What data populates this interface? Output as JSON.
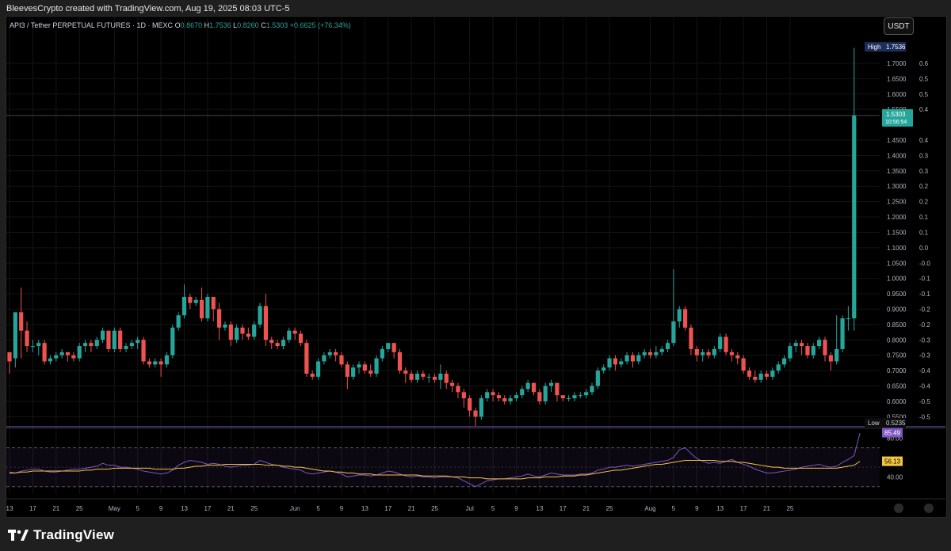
{
  "caption": "BleevesCrypto created with TradingView.com, Aug 19, 2025 08:03 UTC-5",
  "brand": "TradingView",
  "currency_button": "USDT",
  "legend": {
    "symbol": "API3 / Tether PERPETUAL FUTURES · 1D · MEXC",
    "o_label": "O",
    "o_value": "0.8670",
    "h_label": "H",
    "h_value": "1.7536",
    "l_label": "L",
    "l_value": "0.8260",
    "c_label": "C",
    "c_value": "1.5303",
    "change": "+0.6625 (+76.34%)"
  },
  "colors": {
    "up": "#26a69a",
    "down": "#ef5350",
    "rsi": "#7e57c2",
    "rsi_ma": "#f5c542",
    "high_tag": "#1e2e5a",
    "price_tag": "#26a69a",
    "rsi_tag": "#7e57c2",
    "ma_tag": "#f5c542"
  },
  "chart_data": {
    "type": "candlestick",
    "price_axis": {
      "min": 0.52,
      "max": 1.79,
      "ticks": [
        "1.7000",
        "1.6500",
        "1.6000",
        "1.5500",
        "1.4500",
        "1.4000",
        "1.3500",
        "1.3000",
        "1.2500",
        "1.2000",
        "1.1500",
        "1.1000",
        "1.0500",
        "1.0000",
        "0.9500",
        "0.9000",
        "0.8500",
        "0.8000",
        "0.7500",
        "0.7000",
        "0.6500",
        "0.6000",
        "0.5500"
      ],
      "right_ticks": [
        "0.6",
        "0.5",
        "0.5",
        "0.4",
        "0.4",
        "0.3",
        "0.3",
        "0.2",
        "0.2",
        "0.1",
        "0.1",
        "0.0",
        "-0.0",
        "-0.1",
        "-0.1",
        "-0.2",
        "-0.2",
        "-0.3",
        "-0.3",
        "-0.4",
        "-0.4",
        "-0.5",
        "-0.5"
      ]
    },
    "high_label": "High",
    "high_value": "1.7536",
    "low_label": "Low",
    "low_value": "0.5235",
    "last_price": "1.5303",
    "countdown": "10:56:54",
    "candles": [
      [
        0.76,
        0.73,
        0.69,
        0.74
      ],
      [
        0.74,
        0.89,
        0.71,
        0.89
      ],
      [
        0.89,
        0.83,
        0.74,
        0.97
      ],
      [
        0.83,
        0.78,
        0.76,
        0.86
      ],
      [
        0.78,
        0.78,
        0.76,
        0.8
      ],
      [
        0.78,
        0.79,
        0.75,
        0.8
      ],
      [
        0.79,
        0.73,
        0.72,
        0.8
      ],
      [
        0.73,
        0.74,
        0.72,
        0.75
      ],
      [
        0.74,
        0.75,
        0.73,
        0.76
      ],
      [
        0.75,
        0.76,
        0.74,
        0.77
      ],
      [
        0.76,
        0.75,
        0.73,
        0.76
      ],
      [
        0.75,
        0.74,
        0.73,
        0.76
      ],
      [
        0.74,
        0.78,
        0.73,
        0.79
      ],
      [
        0.78,
        0.79,
        0.76,
        0.8
      ],
      [
        0.79,
        0.78,
        0.76,
        0.8
      ],
      [
        0.78,
        0.8,
        0.77,
        0.81
      ],
      [
        0.8,
        0.83,
        0.79,
        0.84
      ],
      [
        0.83,
        0.77,
        0.76,
        0.83
      ],
      [
        0.77,
        0.83,
        0.76,
        0.84
      ],
      [
        0.83,
        0.77,
        0.76,
        0.84
      ],
      [
        0.77,
        0.78,
        0.76,
        0.79
      ],
      [
        0.78,
        0.79,
        0.77,
        0.8
      ],
      [
        0.79,
        0.8,
        0.77,
        0.81
      ],
      [
        0.8,
        0.73,
        0.72,
        0.81
      ],
      [
        0.73,
        0.72,
        0.71,
        0.74
      ],
      [
        0.72,
        0.73,
        0.71,
        0.74
      ],
      [
        0.73,
        0.72,
        0.68,
        0.74
      ],
      [
        0.72,
        0.75,
        0.71,
        0.76
      ],
      [
        0.75,
        0.84,
        0.74,
        0.85
      ],
      [
        0.84,
        0.88,
        0.83,
        0.89
      ],
      [
        0.88,
        0.94,
        0.87,
        0.98
      ],
      [
        0.94,
        0.92,
        0.9,
        0.95
      ],
      [
        0.92,
        0.93,
        0.91,
        0.94
      ],
      [
        0.93,
        0.87,
        0.86,
        0.97
      ],
      [
        0.87,
        0.94,
        0.86,
        0.95
      ],
      [
        0.94,
        0.9,
        0.86,
        0.94
      ],
      [
        0.9,
        0.84,
        0.8,
        0.92
      ],
      [
        0.84,
        0.85,
        0.83,
        0.86
      ],
      [
        0.85,
        0.8,
        0.78,
        0.86
      ],
      [
        0.8,
        0.84,
        0.79,
        0.85
      ],
      [
        0.84,
        0.82,
        0.8,
        0.85
      ],
      [
        0.82,
        0.81,
        0.8,
        0.84
      ],
      [
        0.81,
        0.85,
        0.8,
        0.86
      ],
      [
        0.85,
        0.91,
        0.84,
        0.92
      ],
      [
        0.91,
        0.8,
        0.78,
        0.95
      ],
      [
        0.8,
        0.79,
        0.77,
        0.81
      ],
      [
        0.79,
        0.78,
        0.77,
        0.8
      ],
      [
        0.78,
        0.8,
        0.77,
        0.81
      ],
      [
        0.8,
        0.83,
        0.79,
        0.84
      ],
      [
        0.83,
        0.82,
        0.8,
        0.84
      ],
      [
        0.82,
        0.79,
        0.78,
        0.83
      ],
      [
        0.79,
        0.69,
        0.68,
        0.8
      ],
      [
        0.69,
        0.68,
        0.67,
        0.7
      ],
      [
        0.68,
        0.73,
        0.67,
        0.74
      ],
      [
        0.73,
        0.75,
        0.72,
        0.76
      ],
      [
        0.75,
        0.76,
        0.74,
        0.77
      ],
      [
        0.76,
        0.75,
        0.73,
        0.77
      ],
      [
        0.75,
        0.72,
        0.71,
        0.76
      ],
      [
        0.72,
        0.68,
        0.64,
        0.73
      ],
      [
        0.68,
        0.71,
        0.67,
        0.72
      ],
      [
        0.71,
        0.72,
        0.69,
        0.73
      ],
      [
        0.72,
        0.7,
        0.69,
        0.73
      ],
      [
        0.7,
        0.69,
        0.68,
        0.72
      ],
      [
        0.69,
        0.74,
        0.68,
        0.75
      ],
      [
        0.74,
        0.77,
        0.73,
        0.78
      ],
      [
        0.77,
        0.79,
        0.76,
        0.79
      ],
      [
        0.79,
        0.76,
        0.74,
        0.79
      ],
      [
        0.76,
        0.7,
        0.69,
        0.77
      ],
      [
        0.7,
        0.69,
        0.66,
        0.71
      ],
      [
        0.69,
        0.67,
        0.66,
        0.7
      ],
      [
        0.67,
        0.69,
        0.66,
        0.7
      ],
      [
        0.69,
        0.68,
        0.67,
        0.7
      ],
      [
        0.68,
        0.68,
        0.66,
        0.69
      ],
      [
        0.68,
        0.67,
        0.66,
        0.69
      ],
      [
        0.67,
        0.69,
        0.64,
        0.72
      ],
      [
        0.69,
        0.66,
        0.64,
        0.7
      ],
      [
        0.66,
        0.65,
        0.63,
        0.67
      ],
      [
        0.65,
        0.63,
        0.61,
        0.66
      ],
      [
        0.63,
        0.61,
        0.58,
        0.64
      ],
      [
        0.61,
        0.57,
        0.55,
        0.62
      ],
      [
        0.57,
        0.55,
        0.52,
        0.58
      ],
      [
        0.55,
        0.61,
        0.54,
        0.62
      ],
      [
        0.61,
        0.63,
        0.6,
        0.64
      ],
      [
        0.63,
        0.62,
        0.6,
        0.64
      ],
      [
        0.62,
        0.61,
        0.6,
        0.63
      ],
      [
        0.61,
        0.6,
        0.59,
        0.62
      ],
      [
        0.6,
        0.61,
        0.59,
        0.62
      ],
      [
        0.61,
        0.62,
        0.6,
        0.63
      ],
      [
        0.62,
        0.64,
        0.61,
        0.65
      ],
      [
        0.64,
        0.66,
        0.63,
        0.67
      ],
      [
        0.66,
        0.63,
        0.62,
        0.66
      ],
      [
        0.63,
        0.6,
        0.59,
        0.64
      ],
      [
        0.6,
        0.65,
        0.59,
        0.66
      ],
      [
        0.65,
        0.66,
        0.63,
        0.67
      ],
      [
        0.66,
        0.62,
        0.6,
        0.66
      ],
      [
        0.62,
        0.61,
        0.6,
        0.62
      ],
      [
        0.61,
        0.61,
        0.6,
        0.62
      ],
      [
        0.61,
        0.62,
        0.6,
        0.63
      ],
      [
        0.62,
        0.62,
        0.61,
        0.63
      ],
      [
        0.62,
        0.63,
        0.61,
        0.64
      ],
      [
        0.63,
        0.65,
        0.62,
        0.66
      ],
      [
        0.65,
        0.7,
        0.64,
        0.71
      ],
      [
        0.7,
        0.71,
        0.69,
        0.72
      ],
      [
        0.71,
        0.74,
        0.7,
        0.75
      ],
      [
        0.74,
        0.72,
        0.7,
        0.75
      ],
      [
        0.72,
        0.73,
        0.71,
        0.74
      ],
      [
        0.73,
        0.75,
        0.72,
        0.76
      ],
      [
        0.75,
        0.73,
        0.71,
        0.76
      ],
      [
        0.73,
        0.75,
        0.72,
        0.76
      ],
      [
        0.75,
        0.76,
        0.74,
        0.77
      ],
      [
        0.76,
        0.75,
        0.74,
        0.77
      ],
      [
        0.75,
        0.76,
        0.74,
        0.78
      ],
      [
        0.76,
        0.77,
        0.75,
        0.78
      ],
      [
        0.77,
        0.79,
        0.76,
        0.8
      ],
      [
        0.79,
        0.86,
        0.78,
        1.03
      ],
      [
        0.86,
        0.9,
        0.84,
        0.91
      ],
      [
        0.9,
        0.84,
        0.83,
        0.91
      ],
      [
        0.84,
        0.77,
        0.75,
        0.85
      ],
      [
        0.77,
        0.75,
        0.73,
        0.78
      ],
      [
        0.75,
        0.76,
        0.73,
        0.77
      ],
      [
        0.76,
        0.75,
        0.74,
        0.77
      ],
      [
        0.75,
        0.77,
        0.74,
        0.78
      ],
      [
        0.77,
        0.81,
        0.76,
        0.82
      ],
      [
        0.81,
        0.76,
        0.75,
        0.82
      ],
      [
        0.76,
        0.75,
        0.73,
        0.77
      ],
      [
        0.75,
        0.74,
        0.72,
        0.76
      ],
      [
        0.74,
        0.7,
        0.69,
        0.75
      ],
      [
        0.7,
        0.68,
        0.67,
        0.71
      ],
      [
        0.68,
        0.67,
        0.66,
        0.7
      ],
      [
        0.67,
        0.69,
        0.66,
        0.7
      ],
      [
        0.69,
        0.68,
        0.67,
        0.7
      ],
      [
        0.68,
        0.7,
        0.67,
        0.71
      ],
      [
        0.7,
        0.72,
        0.69,
        0.73
      ],
      [
        0.72,
        0.74,
        0.71,
        0.75
      ],
      [
        0.74,
        0.78,
        0.73,
        0.79
      ],
      [
        0.78,
        0.79,
        0.76,
        0.8
      ],
      [
        0.79,
        0.78,
        0.75,
        0.8
      ],
      [
        0.78,
        0.75,
        0.74,
        0.79
      ],
      [
        0.75,
        0.78,
        0.74,
        0.79
      ],
      [
        0.78,
        0.8,
        0.77,
        0.81
      ],
      [
        0.8,
        0.75,
        0.73,
        0.81
      ],
      [
        0.75,
        0.73,
        0.7,
        0.76
      ],
      [
        0.73,
        0.77,
        0.72,
        0.88
      ],
      [
        0.77,
        0.87,
        0.76,
        0.88
      ],
      [
        0.87,
        0.87,
        0.83,
        0.91
      ],
      [
        0.87,
        1.53,
        0.83,
        1.75
      ]
    ],
    "x_ticks": [
      {
        "label": "13",
        "i": 0
      },
      {
        "label": "17",
        "i": 4
      },
      {
        "label": "21",
        "i": 8
      },
      {
        "label": "25",
        "i": 12
      },
      {
        "label": "May",
        "i": 18
      },
      {
        "label": "5",
        "i": 22
      },
      {
        "label": "9",
        "i": 26
      },
      {
        "label": "13",
        "i": 30
      },
      {
        "label": "17",
        "i": 34
      },
      {
        "label": "21",
        "i": 38
      },
      {
        "label": "25",
        "i": 42
      },
      {
        "label": "Jun",
        "i": 49
      },
      {
        "label": "5",
        "i": 53
      },
      {
        "label": "9",
        "i": 57
      },
      {
        "label": "13",
        "i": 61
      },
      {
        "label": "17",
        "i": 65
      },
      {
        "label": "21",
        "i": 69
      },
      {
        "label": "25",
        "i": 73
      },
      {
        "label": "Jul",
        "i": 79
      },
      {
        "label": "5",
        "i": 83
      },
      {
        "label": "9",
        "i": 87
      },
      {
        "label": "13",
        "i": 91
      },
      {
        "label": "17",
        "i": 95
      },
      {
        "label": "21",
        "i": 99
      },
      {
        "label": "25",
        "i": 103
      },
      {
        "label": "Aug",
        "i": 110
      },
      {
        "label": "5",
        "i": 114
      },
      {
        "label": "9",
        "i": 118
      },
      {
        "label": "13",
        "i": 122
      },
      {
        "label": "17",
        "i": 126
      },
      {
        "label": "21",
        "i": 130
      },
      {
        "label": "25",
        "i": 134
      }
    ],
    "rsi_pane": {
      "ticks": [
        "80.00",
        "40.00"
      ],
      "upper_band": 70,
      "lower_band": 30,
      "rsi_value": "85.49",
      "ma_value": "56.13",
      "rsi": [
        45,
        44,
        46,
        47,
        48,
        48,
        46,
        45,
        45,
        46,
        47,
        48,
        48,
        49,
        50,
        51,
        54,
        52,
        52,
        50,
        50,
        49,
        48,
        46,
        45,
        44,
        43,
        44,
        47,
        52,
        55,
        57,
        56,
        55,
        53,
        54,
        53,
        51,
        50,
        51,
        52,
        52,
        53,
        57,
        55,
        53,
        52,
        50,
        49,
        48,
        47,
        44,
        43,
        44,
        45,
        46,
        45,
        43,
        40,
        41,
        42,
        42,
        41,
        42,
        44,
        46,
        45,
        43,
        41,
        40,
        41,
        40,
        40,
        39,
        40,
        40,
        40,
        39,
        36,
        33,
        30,
        33,
        36,
        37,
        38,
        38,
        39,
        40,
        41,
        43,
        41,
        40,
        42,
        44,
        43,
        42,
        42,
        42,
        43,
        43,
        44,
        47,
        48,
        50,
        50,
        51,
        52,
        51,
        52,
        53,
        54,
        55,
        56,
        57,
        60,
        68,
        70,
        64,
        59,
        56,
        54,
        55,
        54,
        56,
        58,
        55,
        53,
        51,
        48,
        46,
        44,
        44,
        45,
        46,
        47,
        48,
        50,
        51,
        52,
        53,
        51,
        50,
        51,
        55,
        58,
        62,
        85
      ],
      "ma": [
        44,
        44,
        45,
        45,
        46,
        46,
        46,
        46,
        46,
        46,
        46,
        46,
        46,
        47,
        47,
        48,
        48,
        48,
        49,
        49,
        49,
        49,
        49,
        49,
        49,
        48,
        48,
        48,
        48,
        49,
        49,
        50,
        51,
        51,
        52,
        52,
        52,
        53,
        53,
        53,
        53,
        53,
        53,
        53,
        52,
        52,
        52,
        51,
        51,
        50,
        50,
        49,
        48,
        47,
        46,
        46,
        45,
        45,
        44,
        44,
        43,
        43,
        43,
        42,
        42,
        42,
        42,
        42,
        42,
        42,
        42,
        41,
        41,
        41,
        41,
        41,
        40,
        40,
        40,
        39,
        39,
        39,
        38,
        38,
        38,
        38,
        38,
        38,
        38,
        39,
        39,
        39,
        40,
        40,
        40,
        41,
        41,
        41,
        42,
        42,
        43,
        44,
        45,
        46,
        47,
        47,
        48,
        49,
        50,
        51,
        52,
        53,
        53,
        54,
        55,
        56,
        57,
        57,
        57,
        57,
        57,
        57,
        56,
        56,
        56,
        55,
        55,
        54,
        53,
        52,
        51,
        50,
        50,
        49,
        49,
        49,
        49,
        49,
        49,
        49,
        49,
        49,
        49,
        50,
        51,
        52,
        56
      ]
    }
  }
}
